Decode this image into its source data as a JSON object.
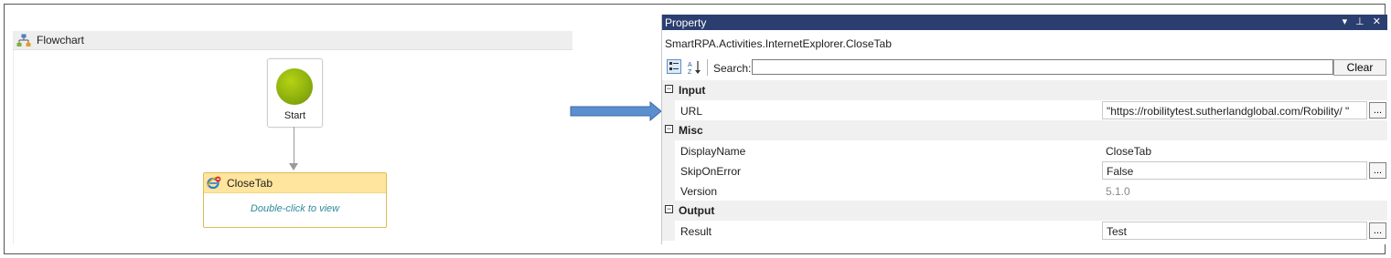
{
  "flowchart": {
    "title": "Flowchart",
    "start_label": "Start",
    "activity": {
      "title": "CloseTab",
      "hint": "Double-click to view"
    }
  },
  "property_panel": {
    "title": "Property",
    "window_buttons": "▾ ⊥ ✕",
    "type_name": "SmartRPA.Activities.InternetExplorer.CloseTab",
    "search_label": "Search:",
    "search_value": "",
    "clear_label": "Clear",
    "categories": [
      {
        "name": "Input",
        "toggle": "⊟",
        "properties": [
          {
            "name": "URL",
            "value": "\"https://robilitytest.sutherlandglobal.com/Robility/ \"",
            "style": "box",
            "has_button": true
          }
        ]
      },
      {
        "name": "Misc",
        "toggle": "⊟",
        "properties": [
          {
            "name": "DisplayName",
            "value": "CloseTab",
            "style": "plain",
            "has_button": false
          },
          {
            "name": "SkipOnError",
            "value": "False",
            "style": "box",
            "has_button": true
          },
          {
            "name": "Version",
            "value": "5.1.0",
            "style": "gray",
            "has_button": false
          }
        ]
      },
      {
        "name": "Output",
        "toggle": "⊟",
        "properties": [
          {
            "name": "Result",
            "value": "Test",
            "style": "box",
            "has_button": true
          }
        ]
      }
    ],
    "ellipsis_label": "..."
  },
  "colors": {
    "titlebar": "#2b3e70",
    "activity_header": "#ffe59d",
    "start_green": "#8fb10e",
    "arrow_blue": "#5b8fd0"
  }
}
